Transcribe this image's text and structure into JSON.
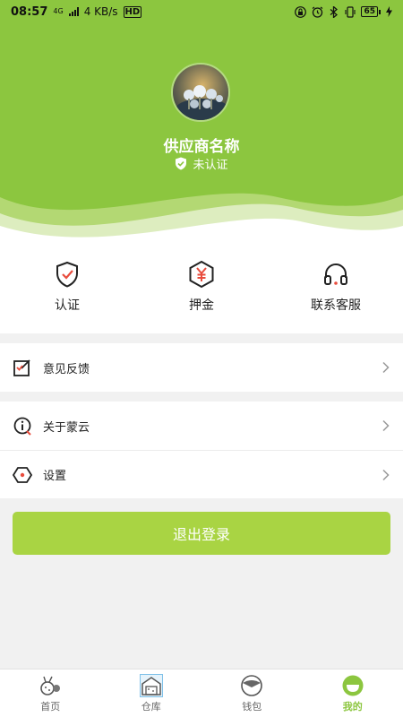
{
  "status_bar": {
    "time": "08:57",
    "network_type": "4G",
    "speed": "4 KB/s",
    "hd_badge": "HD",
    "battery": "65"
  },
  "profile": {
    "name": "供应商名称",
    "verification_status": "未认证"
  },
  "quick_actions": [
    {
      "label": "认证",
      "icon": "shield-check-icon"
    },
    {
      "label": "押金",
      "icon": "yen-hexagon-icon"
    },
    {
      "label": "联系客服",
      "icon": "headset-icon"
    }
  ],
  "menu_group_1": [
    {
      "label": "意见反馈",
      "icon": "feedback-edit-icon"
    }
  ],
  "menu_group_2": [
    {
      "label": "关于蒙云",
      "icon": "info-icon"
    },
    {
      "label": "设置",
      "icon": "settings-hexagon-icon"
    }
  ],
  "logout_label": "退出登录",
  "bottom_nav": [
    {
      "label": "首页",
      "icon": "home-icon",
      "active": false
    },
    {
      "label": "仓库",
      "icon": "warehouse-icon",
      "active": false
    },
    {
      "label": "钱包",
      "icon": "wallet-icon",
      "active": false
    },
    {
      "label": "我的",
      "icon": "profile-icon",
      "active": true
    }
  ],
  "colors": {
    "brand_green": "#8cc63f",
    "button_green": "#a9d443",
    "icon_red": "#e84c3d"
  }
}
